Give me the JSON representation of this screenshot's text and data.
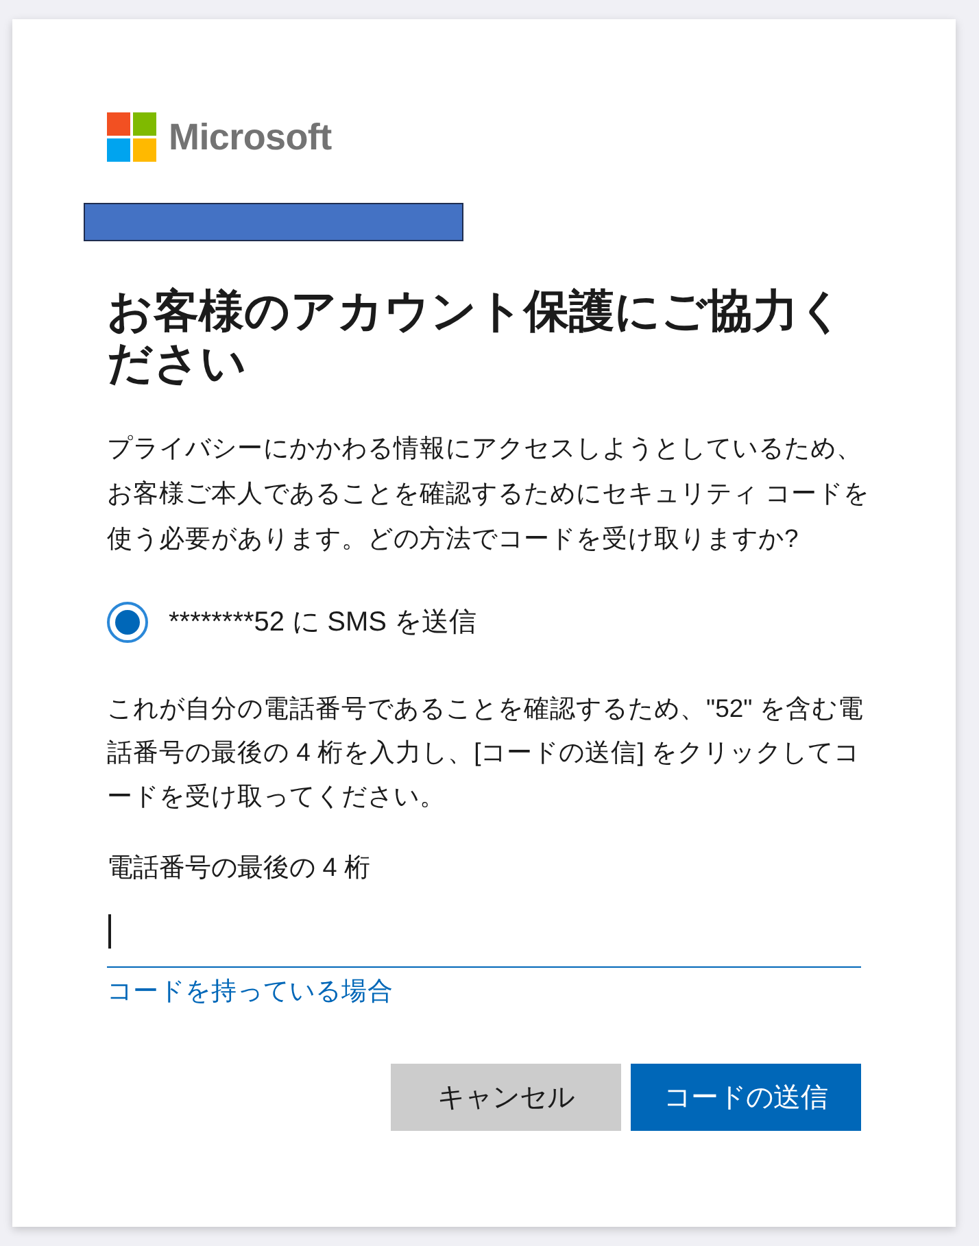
{
  "logo": {
    "text": "Microsoft"
  },
  "title": "お客様のアカウント保護にご協力ください",
  "description": "プライバシーにかかわる情報にアクセスしようとしているため、お客様ご本人であることを確認するためにセキュリティ コードを使う必要があります。どの方法でコードを受け取りますか?",
  "options": [
    {
      "label": "********52 に SMS を送信",
      "selected": true
    }
  ],
  "instructions": "これが自分の電話番号であることを確認するため、\"52\" を含む電話番号の最後の 4 桁を入力し、[コードの送信] をクリックしてコードを受け取ってください。",
  "digits_field": {
    "label": "電話番号の最後の 4 桁",
    "focused": true
  },
  "link": "コードを持っている場合",
  "buttons": [
    {
      "label": "キャンセル",
      "kind": "secondary"
    },
    {
      "label": "コードの送信",
      "kind": "primary"
    }
  ]
}
